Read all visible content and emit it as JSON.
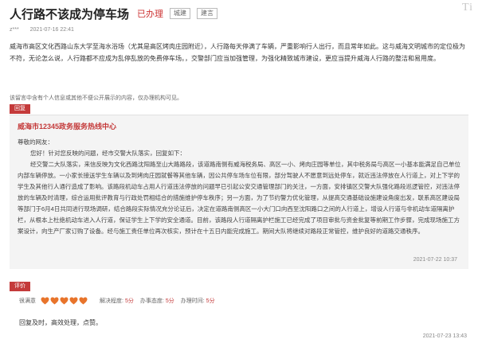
{
  "header": {
    "title": "人行路不该成为停车场",
    "status": "已办理",
    "tags": [
      "城建",
      "建言"
    ],
    "logo_text": "Ti"
  },
  "meta": {
    "author": "z***",
    "date": "2021-07-16 22:41"
  },
  "post": {
    "content": "威海市高区文化西路山东大学至海水浴场（尤其是高区烤肉庄园附近），人行路每天停满了车辆，严重影响行人出行，而且常年如此。这与威海文明城市的定位极为不符，无论怎么说，人行路都不应成为乱停乱放的免费停车场。，交警部门应当加强管理，为强化精致城市建设，更应当提升威海人行路的整洁和易用度。"
  },
  "notice": "该留言中含有个人信息或其他不便公开展示的内容，仅办理机构可见。",
  "reply": {
    "label": "回复",
    "org": "威海市12345政务服务热线中心",
    "greeting": "尊敬的网友：",
    "para1": "您好！针对您反映的问题，经市交警大队落实，回复如下：",
    "para2": "经交警二大队落实，来信反映为文化西路沈阳路至山大路路段，该道路南侧有威海税务局、高区一小、烤肉庄园等单位，其中税务局与高区一小基本能满足自己单位内部车辆停放。一小家长接送学生车辆以及到烤肉庄园就餐等其他车辆，因公共停车场车位有限，部分驾驶人不愿意到远处停车，就近违法停放在人行道上，对上下学的学生及其他行人通行造成了影响。该路段机动车占用人行道违法停放的问题早已引起公安交通管理部门的关注，一方面，安排镇区交警大队强化路段巡逻管控，对违法停放的车辆及时清理，综合运用批评教育与行政处罚相结合的措施维护停车秩序；另一方面，为了节约警力优化管理，从提高交通基础设施建设角度出发，联系高区建设局等部门于6月4日共同进行现场调研，结合路段实际情况充分论证后，决定在道路南侧高区一小大门口向西至沈阳路口之间的人行道上，增设人行道与非机动车道隔离护栏，从根本上杜绝机动车进入人行道，保证学生上下学的安全通道。目前，该路段人行道隔离护栏施工已经完成了项目审批与资金批复等前期工作步骤，完成现场施工方案设计，向生产厂家订购了设备。经与施工责任单位再次核实，预计在十五日内能完成施工。期间大队将继续对路段正常管控，维护良好的道路交通秩序。",
    "time": "2021-07-22 10:37"
  },
  "evaluation": {
    "label": "评价",
    "satisfaction_label": "很满意",
    "hearts": 5,
    "heart_color": "#e8742b",
    "scores": [
      {
        "label": "解决程度:",
        "value": "5分"
      },
      {
        "label": "办事态度:",
        "value": "5分"
      },
      {
        "label": "办理时间:",
        "value": "5分"
      }
    ],
    "comment": "回复及时，高效处理，点赞。",
    "time": "2021-07-23 13:43"
  }
}
